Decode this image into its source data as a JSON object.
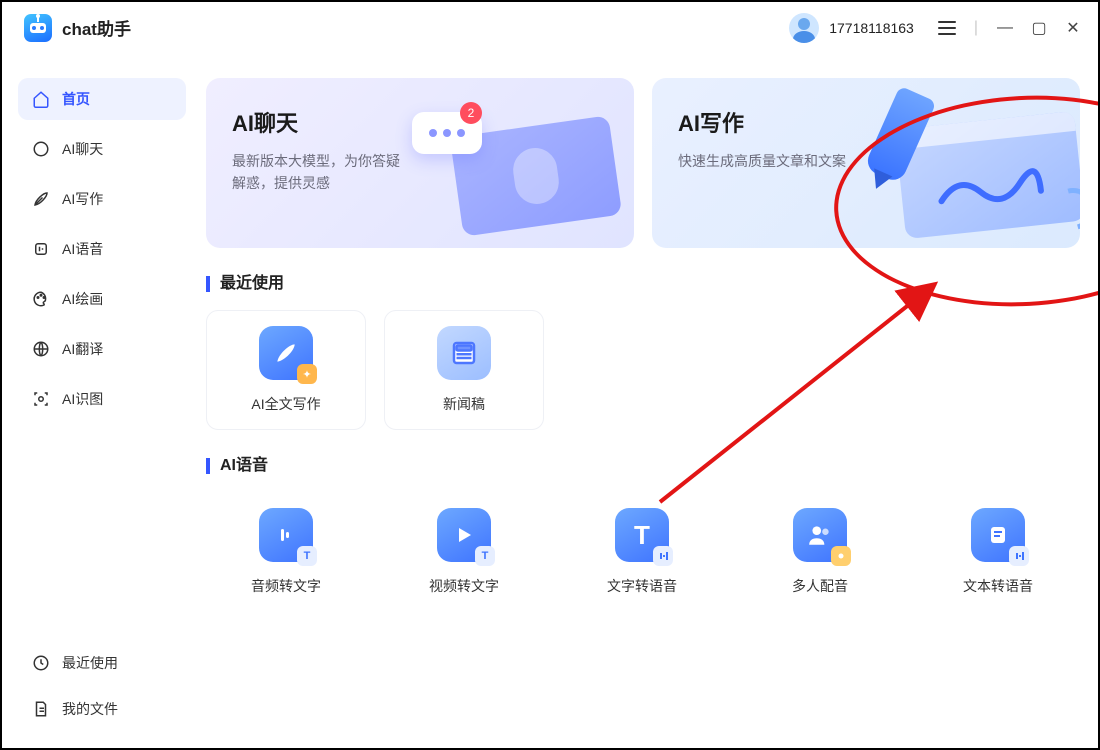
{
  "app": {
    "title": "chat助手"
  },
  "user": {
    "id": "17718118163"
  },
  "sidebar": {
    "items": [
      {
        "label": "首页"
      },
      {
        "label": "AI聊天"
      },
      {
        "label": "AI写作"
      },
      {
        "label": "AI语音"
      },
      {
        "label": "AI绘画"
      },
      {
        "label": "AI翻译"
      },
      {
        "label": "AI识图"
      }
    ],
    "bottom": [
      {
        "label": "最近使用"
      },
      {
        "label": "我的文件"
      }
    ]
  },
  "hero": {
    "chat": {
      "title": "AI聊天",
      "subtitle": "最新版本大模型，为你答疑解惑，提供灵感",
      "badge": "2"
    },
    "write": {
      "title": "AI写作",
      "subtitle": "快速生成高质量文章和文案"
    }
  },
  "sections": {
    "recent": {
      "title": "最近使用",
      "tiles": [
        {
          "label": "AI全文写作"
        },
        {
          "label": "新闻稿"
        }
      ]
    },
    "voice": {
      "title": "AI语音",
      "tiles": [
        {
          "label": "音频转文字"
        },
        {
          "label": "视频转文字"
        },
        {
          "label": "文字转语音"
        },
        {
          "label": "多人配音"
        },
        {
          "label": "文本转语音"
        }
      ]
    }
  }
}
